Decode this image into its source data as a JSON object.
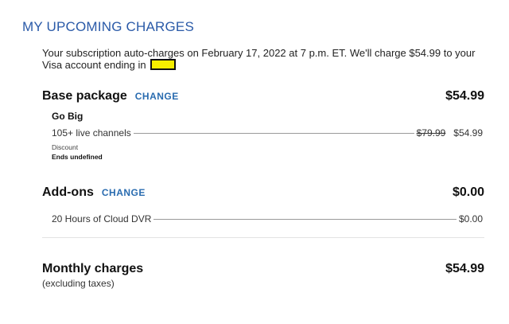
{
  "header": {
    "title": "MY UPCOMING CHARGES"
  },
  "intro": {
    "text": "Your subscription auto-charges on February 17, 2022 at 7 p.m. ET. We'll charge $54.99 to your Visa account ending in"
  },
  "base_package": {
    "heading": "Base package",
    "change_label": "CHANGE",
    "total": "$54.99",
    "package_name": "Go Big",
    "item_label": "105+ live channels",
    "original_price": "$79.99",
    "price": "$54.99",
    "discount_label": "Discount",
    "discount_value": "Ends undefined"
  },
  "addons": {
    "heading": "Add-ons",
    "change_label": "CHANGE",
    "total": "$0.00",
    "item_label": "20 Hours of Cloud DVR",
    "price": "$0.00"
  },
  "monthly": {
    "heading": "Monthly charges",
    "sub": "(excluding taxes)",
    "total": "$54.99"
  },
  "colors": {
    "accent": "#2a5aa8",
    "link": "#2a6cb0",
    "redaction": "#f6ee00"
  }
}
